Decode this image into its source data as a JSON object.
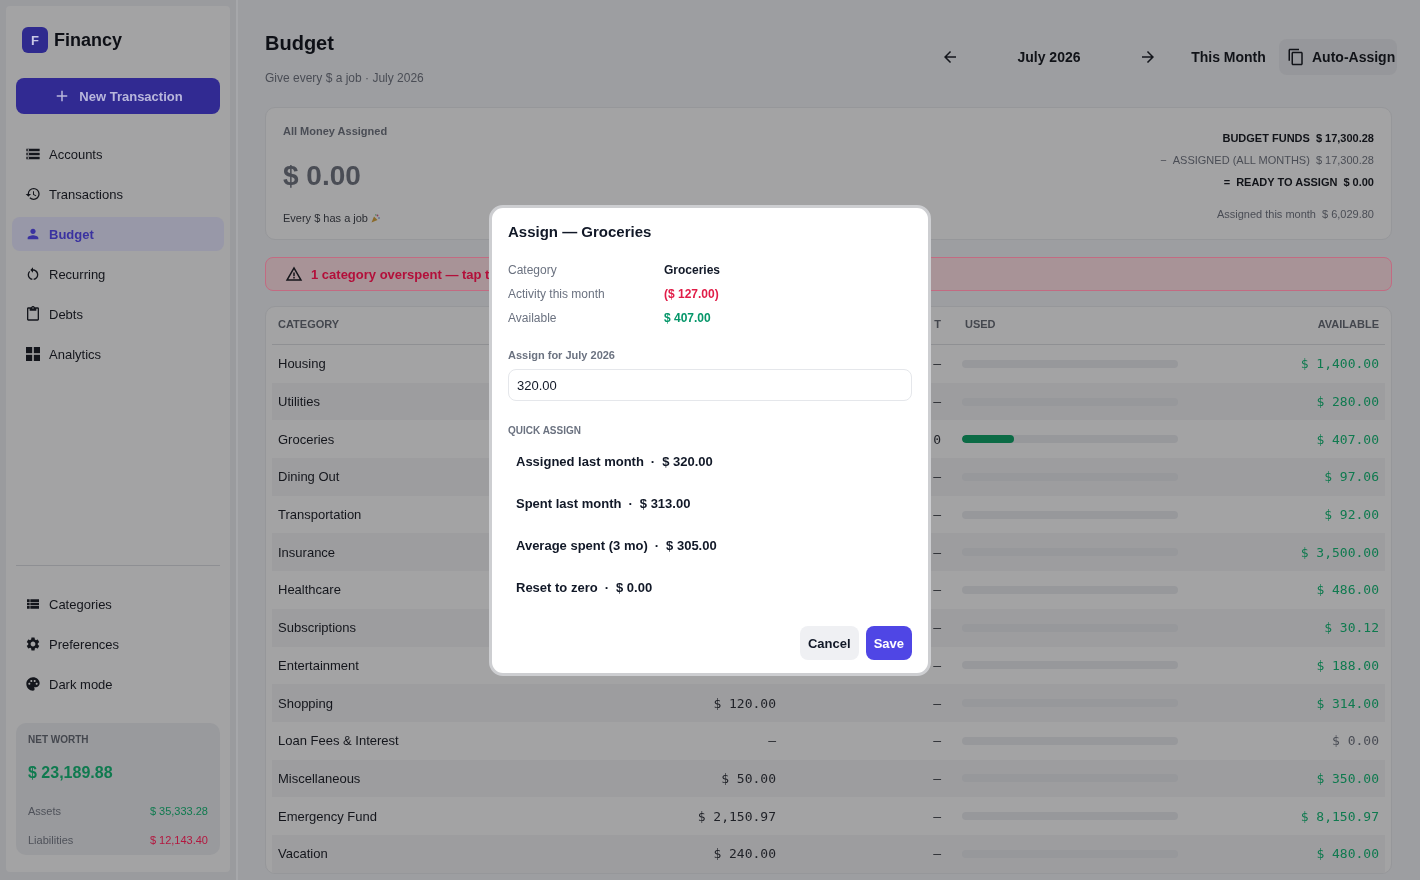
{
  "sidebar": {
    "logo": {
      "letter": "F",
      "name": "Financy"
    },
    "new_button": "New Transaction",
    "nav": [
      {
        "label": "Accounts",
        "selected": false
      },
      {
        "label": "Transactions",
        "selected": false
      },
      {
        "label": "Budget",
        "selected": true
      },
      {
        "label": "Recurring",
        "selected": false
      },
      {
        "label": "Debts",
        "selected": false
      },
      {
        "label": "Analytics",
        "selected": false
      }
    ],
    "bottom_nav": [
      {
        "label": "Categories",
        "selected": false
      },
      {
        "label": "Preferences",
        "selected": false
      },
      {
        "label": "Dark mode",
        "selected": false
      }
    ],
    "net_worth": {
      "title": "NET WORTH",
      "value": "$ 23,189.88",
      "rows": [
        {
          "label": "Assets",
          "value": "$ 35,333.28",
          "color": "#0f7a4f"
        },
        {
          "label": "Liabilities",
          "value": "$ 12,143.40",
          "color": "#b3173f"
        }
      ]
    }
  },
  "header": {
    "title": "Budget",
    "subtitle": "Give every $ a job · July 2026",
    "month": "July 2026",
    "this_month": "This Month",
    "auto_assign": "Auto-Assign"
  },
  "summary": {
    "title": "All Money Assigned",
    "amount": "$ 0.00",
    "note": "Every $ has a job",
    "lines": [
      {
        "label": "BUDGET FUNDS",
        "amount": "$ 17,300.28",
        "bold": true
      },
      {
        "sign": "−",
        "label": "ASSIGNED (ALL MONTHS)",
        "amount": "$ 17,300.28",
        "bold": false
      },
      {
        "sign": "=",
        "label": "READY TO ASSIGN",
        "amount": "$ 0.00",
        "bold": true
      }
    ],
    "assigned_this_month": {
      "label": "Assigned this month",
      "value": "$ 6,029.80"
    }
  },
  "alert": {
    "text": "1 category overspent — tap t"
  },
  "table": {
    "header": {
      "category": "CATEGORY",
      "column_3": "T",
      "used": "USED",
      "available": "AVAILABLE"
    },
    "rows": [
      {
        "category": "Housing",
        "column_3": "–",
        "available": "$ 1,400.00",
        "color": "#0f7a4f"
      },
      {
        "category": "Utilities",
        "column_3": "–",
        "available": "$ 280.00",
        "color": "#0f7a4f"
      },
      {
        "category": "Groceries",
        "column_3": "0",
        "level": 0.24,
        "available": "$ 407.00",
        "color": "#0f7a4f"
      },
      {
        "category": "Dining Out",
        "column_3": "–",
        "available": "$ 97.06",
        "color": "#0f7a4f"
      },
      {
        "category": "Transportation",
        "column_3": "–",
        "available": "$ 92.00",
        "color": "#0f7a4f"
      },
      {
        "category": "Insurance",
        "column_3": "–",
        "available": "$ 3,500.00",
        "color": "#0f7a4f"
      },
      {
        "category": "Healthcare",
        "column_3": "–",
        "available": "$ 486.00",
        "color": "#0f7a4f"
      },
      {
        "category": "Subscriptions",
        "column_3": "–",
        "available": "$ 30.12",
        "color": "#0f7a4f"
      },
      {
        "category": "Entertainment",
        "column_3": "–",
        "available": "$ 188.00",
        "color": "#0f7a4f"
      },
      {
        "category": "Shopping",
        "column_2": "$ 120.00",
        "column_3": "–",
        "available": "$ 314.00",
        "color": "#0f7a4f"
      },
      {
        "category": "Loan Fees & Interest",
        "column_2": "–",
        "column_3": "–",
        "available": "$ 0.00",
        "color": "#4a4d55"
      },
      {
        "category": "Miscellaneous",
        "column_2": "$ 50.00",
        "column_3": "–",
        "available": "$ 350.00",
        "color": "#0f7a4f"
      },
      {
        "category": "Emergency Fund",
        "column_2": "$ 2,150.97",
        "column_3": "–",
        "available": "$ 8,150.97",
        "color": "#0f7a4f"
      },
      {
        "category": "Vacation",
        "column_2": "$ 240.00",
        "column_3": "–",
        "available": "$ 480.00",
        "color": "#0f7a4f"
      }
    ]
  },
  "dialog": {
    "title": "Assign — Groceries",
    "details": [
      {
        "label": "Category",
        "value": "Groceries",
        "color": "#111827"
      },
      {
        "label": "Activity this month",
        "value": "($ 127.00)",
        "color": "#e11d48"
      },
      {
        "label": "Available",
        "value": "$ 407.00",
        "color": "#059669"
      }
    ],
    "field": {
      "label": "Assign for July 2026",
      "value": "320.00"
    },
    "quick_title": "QUICK ASSIGN",
    "quick": [
      {
        "label": "Assigned last month",
        "separator": "·",
        "amount": "$ 320.00"
      },
      {
        "label": "Spent last month",
        "separator": "·",
        "amount": "$ 313.00"
      },
      {
        "label": "Average spent (3 mo)",
        "separator": "·",
        "amount": "$ 305.00"
      },
      {
        "label": "Reset to zero",
        "separator": "·",
        "amount": "$ 0.00"
      }
    ],
    "cancel": "Cancel",
    "save": "Save"
  }
}
